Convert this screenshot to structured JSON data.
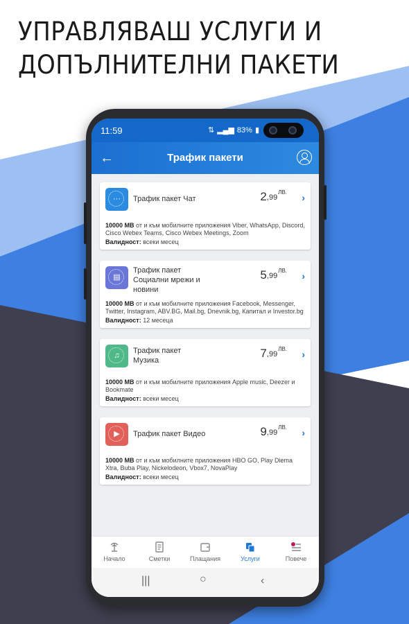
{
  "headline": {
    "line1": "УПРАВЛЯВАШ УСЛУГИ И",
    "line2": "ДОПЪЛНИТЕЛНИ ПАКЕТИ"
  },
  "status_bar": {
    "time": "11:59",
    "battery": "83%"
  },
  "app_bar": {
    "title": "Трафик пакети"
  },
  "packages": [
    {
      "name_lines": [
        "Трафик пакет Чат"
      ],
      "price_int": "2",
      "price_dec": ",99",
      "currency": "ЛВ.",
      "amount": "10000 MB",
      "description": " от и към мобилните приложения Viber, WhatsApp, Discord, Cisco Webex Teams, Cisco Webex Meetings, Zoom",
      "validity_label": "Валидност:",
      "validity_value": " всеки месец",
      "icon": "chat-icon",
      "color": "#2a8be0"
    },
    {
      "name_lines": [
        "Трафик пакет",
        "Социални мрежи и",
        "новини"
      ],
      "price_int": "5",
      "price_dec": ",99",
      "currency": "ЛВ.",
      "amount": "10000 MB",
      "description": " от и към мобилните приложения Facebook, Messenger, Twitter, Instagram, ABV.BG, Mail.bg, Dnevnik.bg, Капитал и Investor.bg",
      "validity_label": "Валидност:",
      "validity_value": " 12 месеца",
      "icon": "newspaper-icon",
      "color": "#6b77d8"
    },
    {
      "name_lines": [
        "Трафик пакет",
        "Музика"
      ],
      "price_int": "7",
      "price_dec": ",99",
      "currency": "ЛВ.",
      "amount": "10000 MB",
      "description": " от и към мобилните приложения Apple music, Deezer и Bookmate",
      "validity_label": "Валидност:",
      "validity_value": " всеки месец",
      "icon": "headphones-icon",
      "color": "#4fb98a"
    },
    {
      "name_lines": [
        "Трафик пакет Видео"
      ],
      "price_int": "9",
      "price_dec": ",99",
      "currency": "ЛВ.",
      "amount": "10000 MB",
      "description": " от и към мобилните приложения HBO GO, Play Diema Xtra, Buba Play, Nickelodeon, Vbox7, NovaPlay",
      "validity_label": "Валидност:",
      "validity_value": " всеки месец",
      "icon": "video-play-icon",
      "color": "#e2605a"
    }
  ],
  "bottom_nav": [
    {
      "label": "Начало",
      "icon": "home-antenna-icon",
      "active": false
    },
    {
      "label": "Сметки",
      "icon": "bill-icon",
      "active": false
    },
    {
      "label": "Плащания",
      "icon": "wallet-icon",
      "active": false
    },
    {
      "label": "Услуги",
      "icon": "services-icon",
      "active": true
    },
    {
      "label": "Повече",
      "icon": "more-menu-icon",
      "active": false
    }
  ],
  "colors": {
    "primary": "#1b6fd1",
    "accent": "#1f78d1",
    "nav_dot": "#c2185b",
    "bg_dark": "#3f3e4e",
    "bg_blue": "#3d7fe0",
    "bg_light_blue": "#8fb6ef"
  }
}
